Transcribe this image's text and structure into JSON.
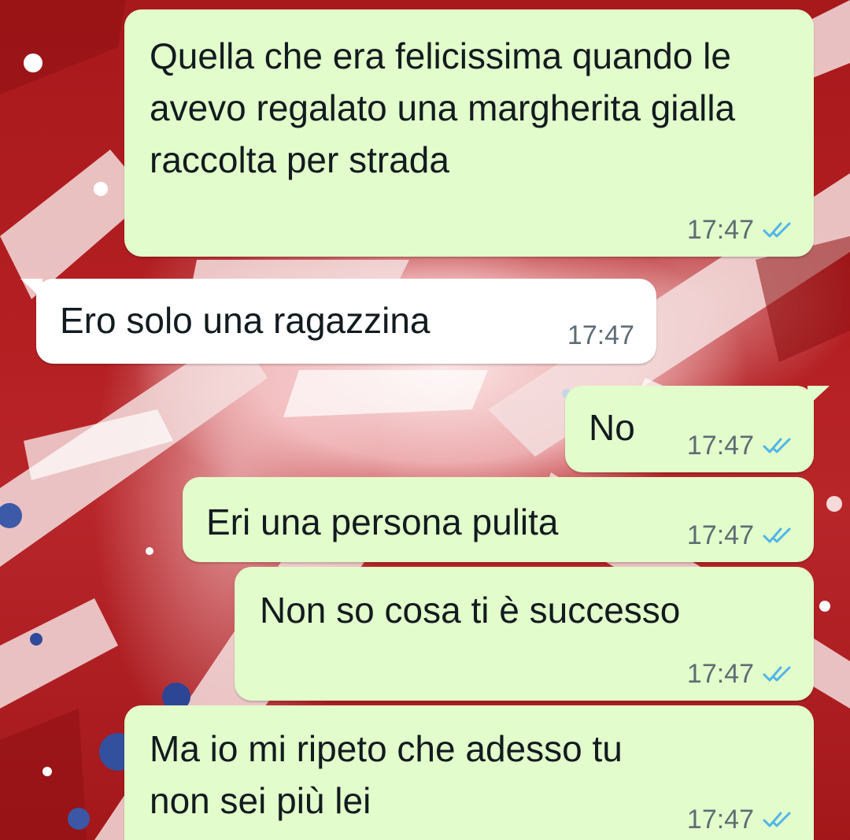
{
  "colors": {
    "outgoing_bubble": "#e2fdcb",
    "incoming_bubble": "#ffffff",
    "read_ticks": "#4fb5e9",
    "timestamp": "#5d6d73",
    "wallpaper_red": "#b31c1f"
  },
  "messages": [
    {
      "direction": "outgoing",
      "text": "Quella che era felicissima quando le avevo regalato una margherita gialla raccolta per strada",
      "time": "17:47",
      "status_icon": "double-check-read-icon"
    },
    {
      "direction": "incoming",
      "text": "Ero solo una ragazzina",
      "time": "17:47"
    },
    {
      "direction": "outgoing",
      "text": "No",
      "time": "17:47",
      "status_icon": "double-check-read-icon"
    },
    {
      "direction": "outgoing",
      "text": "Eri una persona pulita",
      "time": "17:47",
      "status_icon": "double-check-read-icon"
    },
    {
      "direction": "outgoing",
      "text": "Non so cosa ti è successo",
      "time": "17:47",
      "status_icon": "double-check-read-icon"
    },
    {
      "direction": "outgoing",
      "text": "Ma io mi ripeto che adesso tu non sei più lei",
      "time": "17:47",
      "status_icon": "double-check-read-icon"
    }
  ]
}
